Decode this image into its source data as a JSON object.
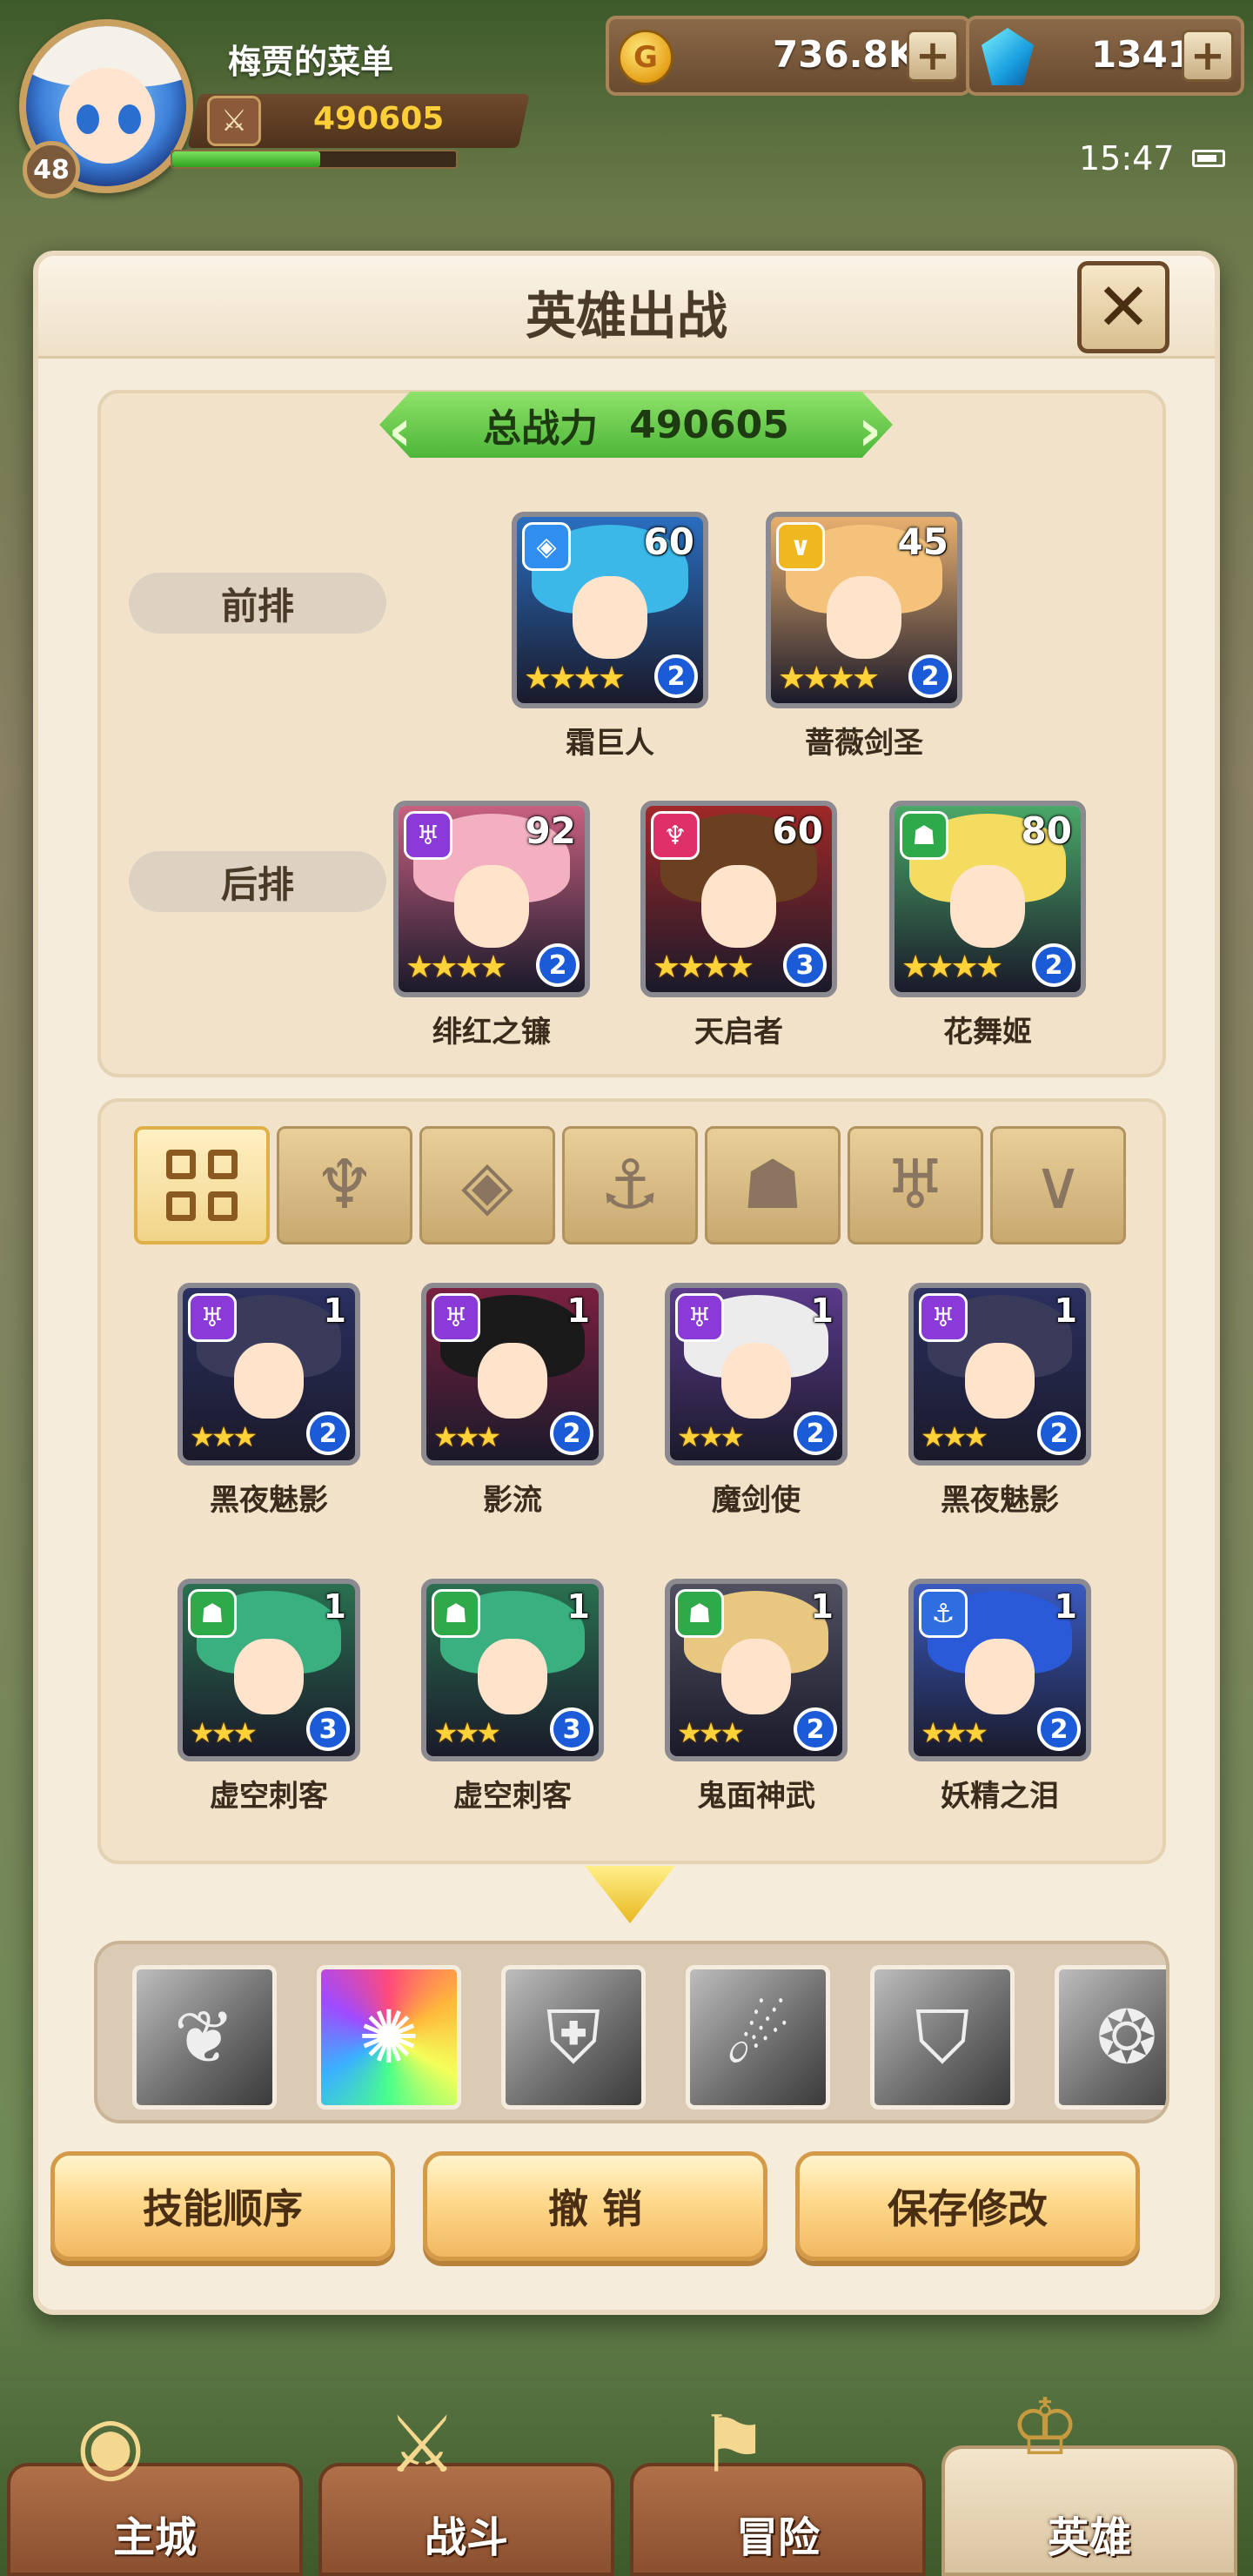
{
  "player": {
    "name": "梅贾的菜单",
    "level": "48",
    "power": "490605",
    "exp_fraction": 0.52
  },
  "resources": {
    "gold": "736.8K",
    "gems": "1341",
    "plus": "+"
  },
  "status": {
    "time": "15:47"
  },
  "modal": {
    "title": "英雄出战",
    "close": "✕",
    "total_power_label": "总战力",
    "total_power_value": "490605",
    "front_row_label": "前排",
    "back_row_label": "后排"
  },
  "front_row": [
    {
      "name": "霜巨人",
      "level": "60",
      "stars": "★★★★",
      "rank": "2",
      "class_icon": "crystal-icon",
      "class_color": "#2f8ef0",
      "hair_color": "#3bb8e8",
      "bg": "#2a6ec0"
    },
    {
      "name": "蔷薇剑圣",
      "level": "45",
      "stars": "★★★★",
      "rank": "2",
      "class_icon": "chevron-icon",
      "class_color": "#f0b820",
      "hair_color": "#f4c27a",
      "bg": "#e8b070"
    }
  ],
  "back_row": [
    {
      "name": "绯红之镰",
      "level": "92",
      "stars": "★★★★",
      "rank": "2",
      "class_icon": "horn-icon",
      "class_color": "#8a3ad8",
      "hair_color": "#f2b0c0",
      "bg": "#c86080"
    },
    {
      "name": "天启者",
      "level": "60",
      "stars": "★★★★",
      "rank": "3",
      "class_icon": "flame-icon",
      "class_color": "#e0306a",
      "hair_color": "#6a4020",
      "bg": "#a02828"
    },
    {
      "name": "花舞姬",
      "level": "80",
      "stars": "★★★★",
      "rank": "2",
      "class_icon": "beast-icon",
      "class_color": "#2faa4a",
      "hair_color": "#f4dc60",
      "bg": "#4aa868"
    }
  ],
  "filters": [
    {
      "name": "all-filter",
      "glyph": ""
    },
    {
      "name": "flame-filter",
      "glyph": "♆"
    },
    {
      "name": "crystal-filter",
      "glyph": "◈"
    },
    {
      "name": "anchor-filter",
      "glyph": "⚓"
    },
    {
      "name": "beast-filter",
      "glyph": "☗"
    },
    {
      "name": "horn-filter",
      "glyph": "♅"
    },
    {
      "name": "chevron-filter",
      "glyph": "∨"
    }
  ],
  "roster": [
    {
      "name": "黑夜魅影",
      "level": "1",
      "stars": "★★★",
      "rank": "2",
      "class_icon": "horn-icon",
      "class_color": "#8a3ad8",
      "hair_color": "#3a3a5a",
      "bg": "#2a3060"
    },
    {
      "name": "影流",
      "level": "1",
      "stars": "★★★",
      "rank": "2",
      "class_icon": "horn-icon",
      "class_color": "#8a3ad8",
      "hair_color": "#1a1a1a",
      "bg": "#7a2040"
    },
    {
      "name": "魔剑使",
      "level": "1",
      "stars": "★★★",
      "rank": "2",
      "class_icon": "horn-icon",
      "class_color": "#8a3ad8",
      "hair_color": "#ececec",
      "bg": "#5a3a8a"
    },
    {
      "name": "黑夜魅影",
      "level": "1",
      "stars": "★★★",
      "rank": "2",
      "class_icon": "horn-icon",
      "class_color": "#8a3ad8",
      "hair_color": "#3a3a5a",
      "bg": "#2a3060"
    },
    {
      "name": "虚空刺客",
      "level": "1",
      "stars": "★★★",
      "rank": "3",
      "class_icon": "beast-icon",
      "class_color": "#2faa4a",
      "hair_color": "#3ab080",
      "bg": "#2a7050"
    },
    {
      "name": "虚空刺客",
      "level": "1",
      "stars": "★★★",
      "rank": "3",
      "class_icon": "beast-icon",
      "class_color": "#2faa4a",
      "hair_color": "#3ab080",
      "bg": "#2a7050"
    },
    {
      "name": "鬼面神武",
      "level": "1",
      "stars": "★★★",
      "rank": "2",
      "class_icon": "beast-icon",
      "class_color": "#2faa4a",
      "hair_color": "#e8c880",
      "bg": "#505060"
    },
    {
      "name": "妖精之泪",
      "level": "1",
      "stars": "★★★",
      "rank": "2",
      "class_icon": "anchor-icon",
      "class_color": "#2f6ee0",
      "hair_color": "#2a5ad8",
      "bg": "#3a5ac0"
    }
  ],
  "skills": [
    {
      "name": "wing-skill-icon",
      "glyph": "❦",
      "color": false
    },
    {
      "name": "rainbow-skill-icon",
      "glyph": "✺",
      "color": true
    },
    {
      "name": "shield-skill-icon",
      "glyph": "⛨",
      "color": false
    },
    {
      "name": "slash-skill-icon",
      "glyph": "☄",
      "color": false
    },
    {
      "name": "shield-crest-skill-icon",
      "glyph": "⛉",
      "color": false
    },
    {
      "name": "partial-skill-icon",
      "glyph": "❂",
      "color": false
    }
  ],
  "buttons": {
    "skill_order": "技能顺序",
    "cancel": "撤 销",
    "save": "保存修改"
  },
  "nav": [
    {
      "label": "主城",
      "emblem": "◉",
      "active": false
    },
    {
      "label": "战斗",
      "emblem": "⚔",
      "active": false
    },
    {
      "label": "冒险",
      "emblem": "⚑",
      "active": false
    },
    {
      "label": "英雄",
      "emblem": "♔",
      "active": true
    }
  ]
}
